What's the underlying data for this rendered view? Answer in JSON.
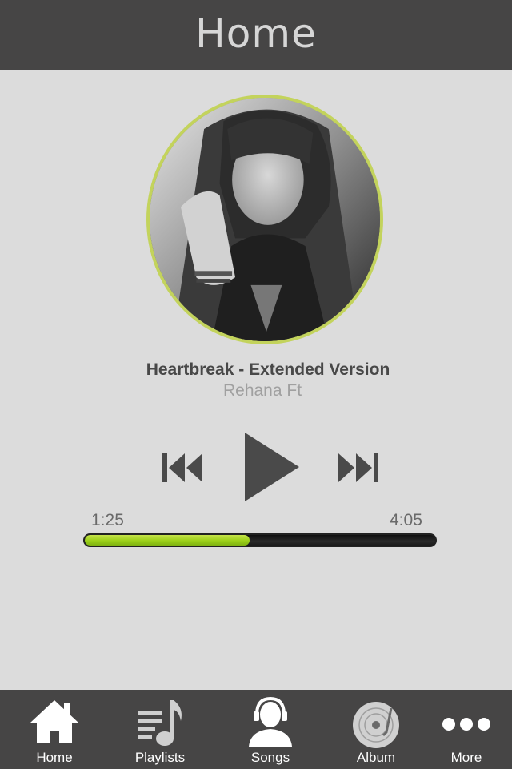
{
  "header": {
    "title": "Home"
  },
  "track": {
    "title": "Heartbreak - Extended Version",
    "artist": "Rehana Ft",
    "art_icon": "album-cover-photo",
    "ring_color": "#c3d35c"
  },
  "controls": {
    "previous_icon": "skip-previous-icon",
    "play_icon": "play-icon",
    "next_icon": "skip-next-icon"
  },
  "progress": {
    "elapsed": "1:25",
    "total": "4:05",
    "fraction": 0.47,
    "fill_color": "#9bd019"
  },
  "tabbar": {
    "items": [
      {
        "label": "Home",
        "icon": "home-icon",
        "selected": true
      },
      {
        "label": "Playlists",
        "icon": "playlist-icon",
        "selected": false
      },
      {
        "label": "Songs",
        "icon": "headset-user-icon",
        "selected": false
      },
      {
        "label": "Album",
        "icon": "vinyl-record-icon",
        "selected": false
      },
      {
        "label": "More",
        "icon": "more-dots-icon",
        "selected": false
      }
    ]
  }
}
